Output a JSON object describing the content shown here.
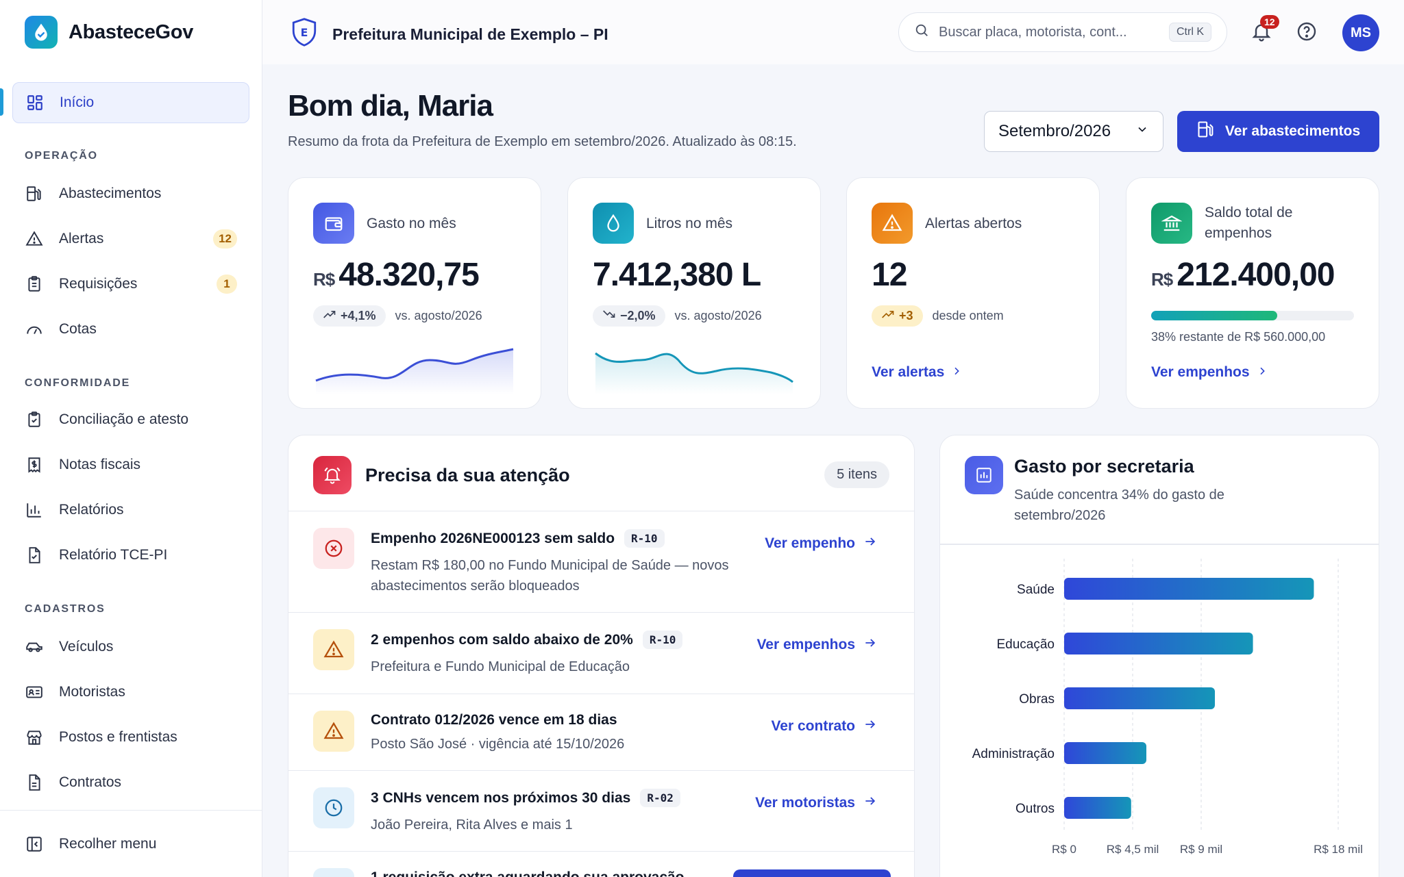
{
  "brand": {
    "name": "AbasteceGov"
  },
  "sidebar": {
    "home": "Início",
    "sections": {
      "operacao": "OPERAÇÃO",
      "conformidade": "CONFORMIDADE",
      "cadastros": "CADASTROS"
    },
    "items": {
      "abastecimentos": "Abastecimentos",
      "alertas": "Alertas",
      "alertas_badge": "12",
      "requisicoes": "Requisições",
      "requisicoes_badge": "1",
      "cotas": "Cotas",
      "conciliacao": "Conciliação e atesto",
      "notas": "Notas fiscais",
      "relatorios": "Relatórios",
      "tce": "Relatório TCE-PI",
      "veiculos": "Veículos",
      "motoristas": "Motoristas",
      "postos": "Postos e frentistas",
      "contratos": "Contratos"
    },
    "collapse": "Recolher menu"
  },
  "topbar": {
    "org_initial": "E",
    "org_name": "Prefeitura Municipal de Exemplo – PI",
    "search_placeholder": "Buscar placa, motorista, cont...",
    "search_kbd": "Ctrl K",
    "notif_count": "12",
    "avatar": "MS"
  },
  "header": {
    "greeting": "Bom dia, Maria",
    "subtitle": "Resumo da frota da Prefeitura de Exemplo em setembro/2026. Atualizado às 08:15.",
    "month": "Setembro/2026",
    "primary": "Ver abastecimentos"
  },
  "kpis": {
    "gasto": {
      "label": "Gasto no mês",
      "currency": "R$",
      "value": "48.320,75",
      "trend": "+4,1%",
      "compare": "vs. agosto/2026"
    },
    "litros": {
      "label": "Litros no mês",
      "value": "7.412,380 L",
      "trend": "−2,0%",
      "compare": "vs. agosto/2026"
    },
    "alertas": {
      "label": "Alertas abertos",
      "value": "12",
      "trend": "+3",
      "compare": "desde ontem",
      "link": "Ver alertas"
    },
    "saldo": {
      "label": "Saldo total de empenhos",
      "currency": "R$",
      "value": "212.400,00",
      "progress": 0.62,
      "note": "38% restante de R$ 560.000,00",
      "link": "Ver empenhos"
    }
  },
  "attention": {
    "title": "Precisa da sua atenção",
    "count": "5 itens",
    "rows": [
      {
        "title": "Empenho 2026NE000123 sem saldo",
        "tag": "R-10",
        "desc": "Restam R$ 180,00 no Fundo Municipal de Saúde — novos abastecimentos serão bloqueados",
        "action": "Ver empenho"
      },
      {
        "title": "2 empenhos com saldo abaixo de 20%",
        "tag": "R-10",
        "desc": "Prefeitura e Fundo Municipal de Educação",
        "action": "Ver empenhos"
      },
      {
        "title": "Contrato 012/2026 vence em 18 dias",
        "desc": "Posto São José · vigência até 15/10/2026",
        "action": "Ver contrato"
      },
      {
        "title": "3 CNHs vencem nos próximos 30 dias",
        "tag": "R-02",
        "desc": "João Pereira, Rita Alves e mais 1",
        "action": "Ver motoristas"
      },
      {
        "title": "1 requisição extra aguardando sua aprovação"
      }
    ]
  },
  "chart_data": {
    "type": "bar",
    "orientation": "horizontal",
    "title": "Gasto por secretaria",
    "subtitle": "Saúde concentra 34% do gasto de setembro/2026",
    "categories": [
      "Saúde",
      "Educação",
      "Obras",
      "Administração",
      "Outros"
    ],
    "values": [
      16.4,
      12.4,
      9.9,
      5.4,
      4.4
    ],
    "xlim": [
      0,
      18
    ],
    "ticks": [
      {
        "value": 0,
        "label": "R$ 0"
      },
      {
        "value": 4.5,
        "label": "R$ 4,5 mil"
      },
      {
        "value": 9,
        "label": "R$ 9 mil"
      },
      {
        "value": 18,
        "label": "R$ 18 mil"
      }
    ],
    "grid": true
  }
}
